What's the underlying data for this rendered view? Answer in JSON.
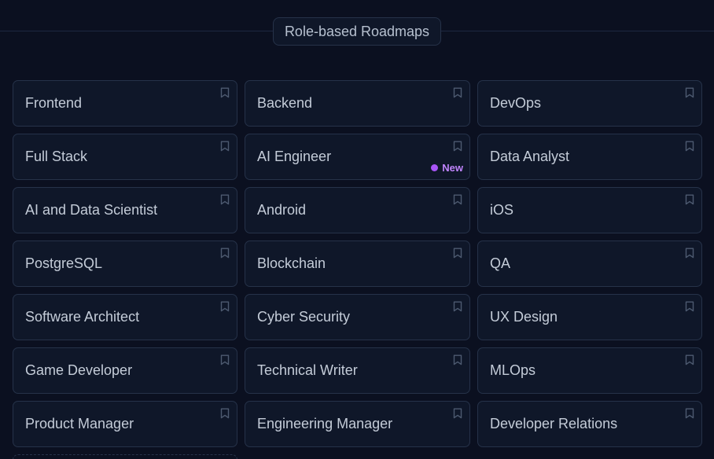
{
  "section": {
    "title": "Role-based Roadmaps"
  },
  "roadmaps": [
    {
      "label": "Frontend",
      "badge": null
    },
    {
      "label": "Backend",
      "badge": null
    },
    {
      "label": "DevOps",
      "badge": null
    },
    {
      "label": "Full Stack",
      "badge": null
    },
    {
      "label": "AI Engineer",
      "badge": "New"
    },
    {
      "label": "Data Analyst",
      "badge": null
    },
    {
      "label": "AI and Data Scientist",
      "badge": null
    },
    {
      "label": "Android",
      "badge": null
    },
    {
      "label": "iOS",
      "badge": null
    },
    {
      "label": "PostgreSQL",
      "badge": null
    },
    {
      "label": "Blockchain",
      "badge": null
    },
    {
      "label": "QA",
      "badge": null
    },
    {
      "label": "Software Architect",
      "badge": null
    },
    {
      "label": "Cyber Security",
      "badge": null
    },
    {
      "label": "UX Design",
      "badge": null
    },
    {
      "label": "Game Developer",
      "badge": null
    },
    {
      "label": "Technical Writer",
      "badge": null
    },
    {
      "label": "MLOps",
      "badge": null
    },
    {
      "label": "Product Manager",
      "badge": null
    },
    {
      "label": "Engineering Manager",
      "badge": null
    },
    {
      "label": "Developer Relations",
      "badge": null
    }
  ],
  "icons": {
    "bookmark": "bookmark-icon"
  },
  "colors": {
    "background": "#0b1020",
    "card": "#0f1729",
    "border": "#263249",
    "text": "#c4ccd8",
    "badge_accent": "#a855f7"
  }
}
